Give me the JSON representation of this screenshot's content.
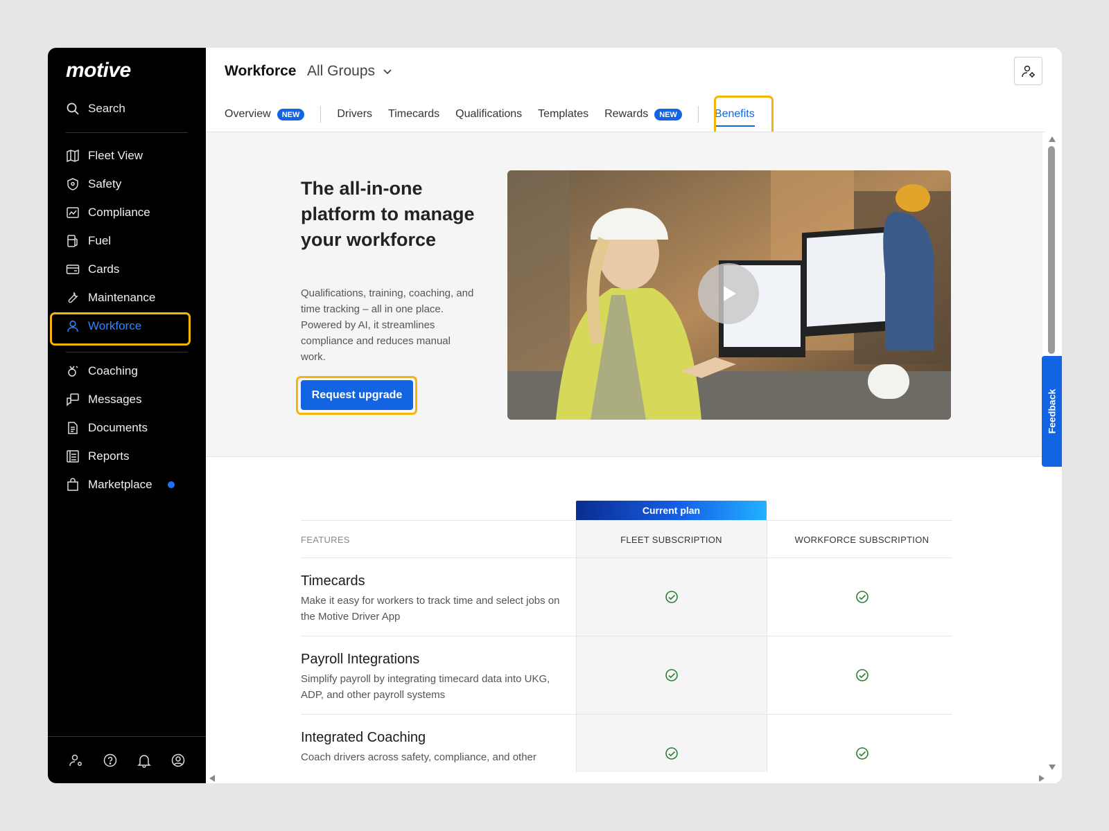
{
  "brand": {
    "logo_text": "motive"
  },
  "sidebar": {
    "search_label": "Search",
    "primary_items": [
      {
        "label": "Fleet View",
        "icon": "map-icon"
      },
      {
        "label": "Safety",
        "icon": "shield-icon"
      },
      {
        "label": "Compliance",
        "icon": "compliance-icon"
      },
      {
        "label": "Fuel",
        "icon": "fuel-icon"
      },
      {
        "label": "Cards",
        "icon": "card-icon"
      },
      {
        "label": "Maintenance",
        "icon": "wrench-icon"
      },
      {
        "label": "Workforce",
        "icon": "person-icon",
        "active": true
      }
    ],
    "secondary_items": [
      {
        "label": "Coaching",
        "icon": "coaching-icon"
      },
      {
        "label": "Messages",
        "icon": "messages-icon"
      },
      {
        "label": "Documents",
        "icon": "document-icon"
      },
      {
        "label": "Reports",
        "icon": "reports-icon"
      },
      {
        "label": "Marketplace",
        "icon": "marketplace-icon",
        "dot": true
      }
    ],
    "bottom_icons": [
      "user-settings-icon",
      "help-icon",
      "bell-icon",
      "account-icon"
    ]
  },
  "header": {
    "title": "Workforce",
    "group_select": "All Groups",
    "tabs": [
      {
        "label": "Overview",
        "badge": "NEW"
      },
      {
        "label": "Drivers"
      },
      {
        "label": "Timecards"
      },
      {
        "label": "Qualifications"
      },
      {
        "label": "Templates"
      },
      {
        "label": "Rewards",
        "badge": "NEW"
      },
      {
        "label": "Benefits",
        "active": true
      }
    ]
  },
  "hero": {
    "heading": "The all-in-one platform to manage your workforce",
    "description": "Qualifications, training, coaching, and time tracking – all in one place. Powered by AI, it streamlines compliance and reduces manual work.",
    "cta_label": "Request upgrade"
  },
  "comparison": {
    "current_plan_label": "Current plan",
    "headers": {
      "features": "FEATURES",
      "fleet": "FLEET SUBSCRIPTION",
      "workforce": "WORKFORCE SUBSCRIPTION"
    },
    "rows": [
      {
        "title": "Timecards",
        "description": "Make it easy for workers to track time and select jobs on the Motive Driver App",
        "fleet": true,
        "workforce": true
      },
      {
        "title": "Payroll Integrations",
        "description": "Simplify payroll by integrating timecard data into UKG, ADP, and other payroll systems",
        "fleet": true,
        "workforce": true
      },
      {
        "title": "Integrated Coaching",
        "description": "Coach drivers across safety, compliance, and other",
        "fleet": true,
        "workforce": true
      }
    ]
  },
  "feedback_label": "Feedback",
  "colors": {
    "accent": "#1264e3",
    "highlight": "#f5b40a",
    "sidebar_bg": "#000000",
    "check": "#2e7d32"
  }
}
